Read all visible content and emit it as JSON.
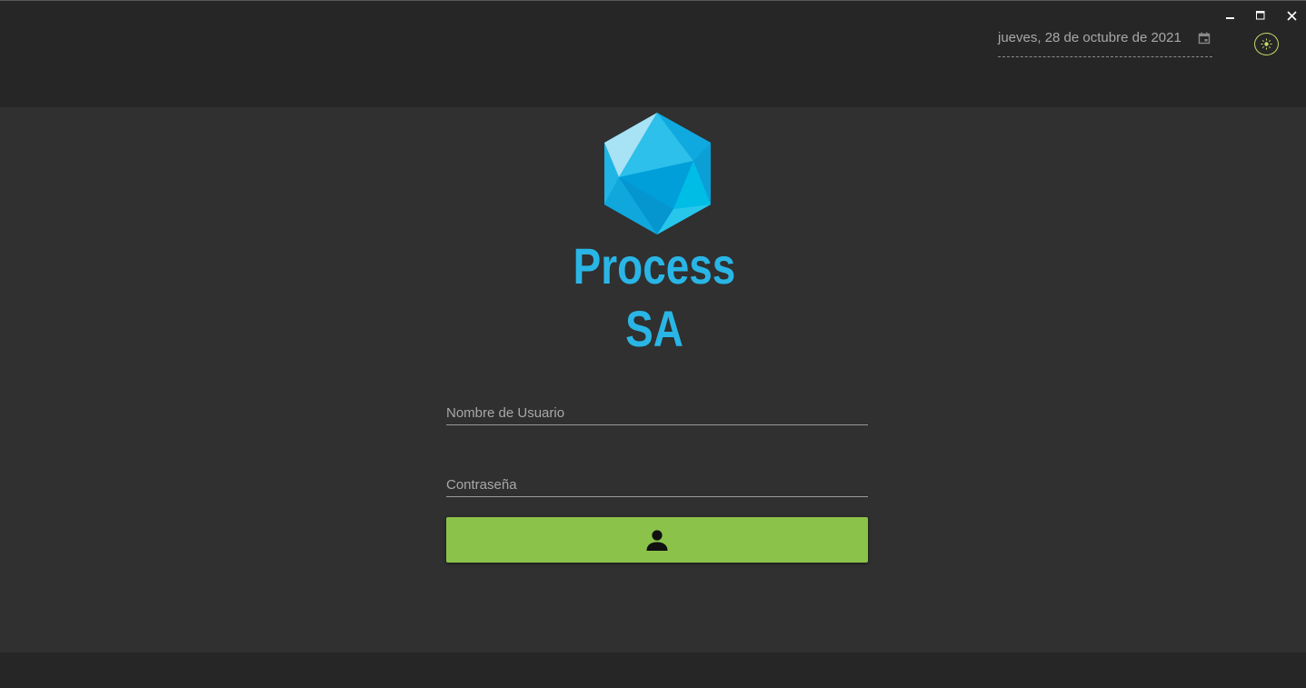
{
  "window_controls": {
    "minimize_icon": "minimize-icon",
    "maximize_icon": "maximize-icon",
    "close_icon": "close-icon",
    "icon_color": "#ffffff"
  },
  "header": {
    "date_value": "jueves, 28 de octubre de 2021",
    "calendar_icon": "calendar-icon",
    "theme_toggle_icon": "sun-icon",
    "theme_toggle_color": "#c9d86a",
    "background": "#262626"
  },
  "brand": {
    "logo_icon": "hexagon-crystal-logo",
    "line1": "Process",
    "line2": "SA",
    "color": "#29b6e6"
  },
  "login_form": {
    "username_placeholder": "Nombre de Usuario",
    "username_value": "",
    "password_placeholder": "Contraseña",
    "password_value": "",
    "submit_icon": "user-icon",
    "submit_color": "#8bc34a"
  },
  "theme": {
    "content_background": "#303030",
    "text_muted": "#a8a8a8"
  }
}
